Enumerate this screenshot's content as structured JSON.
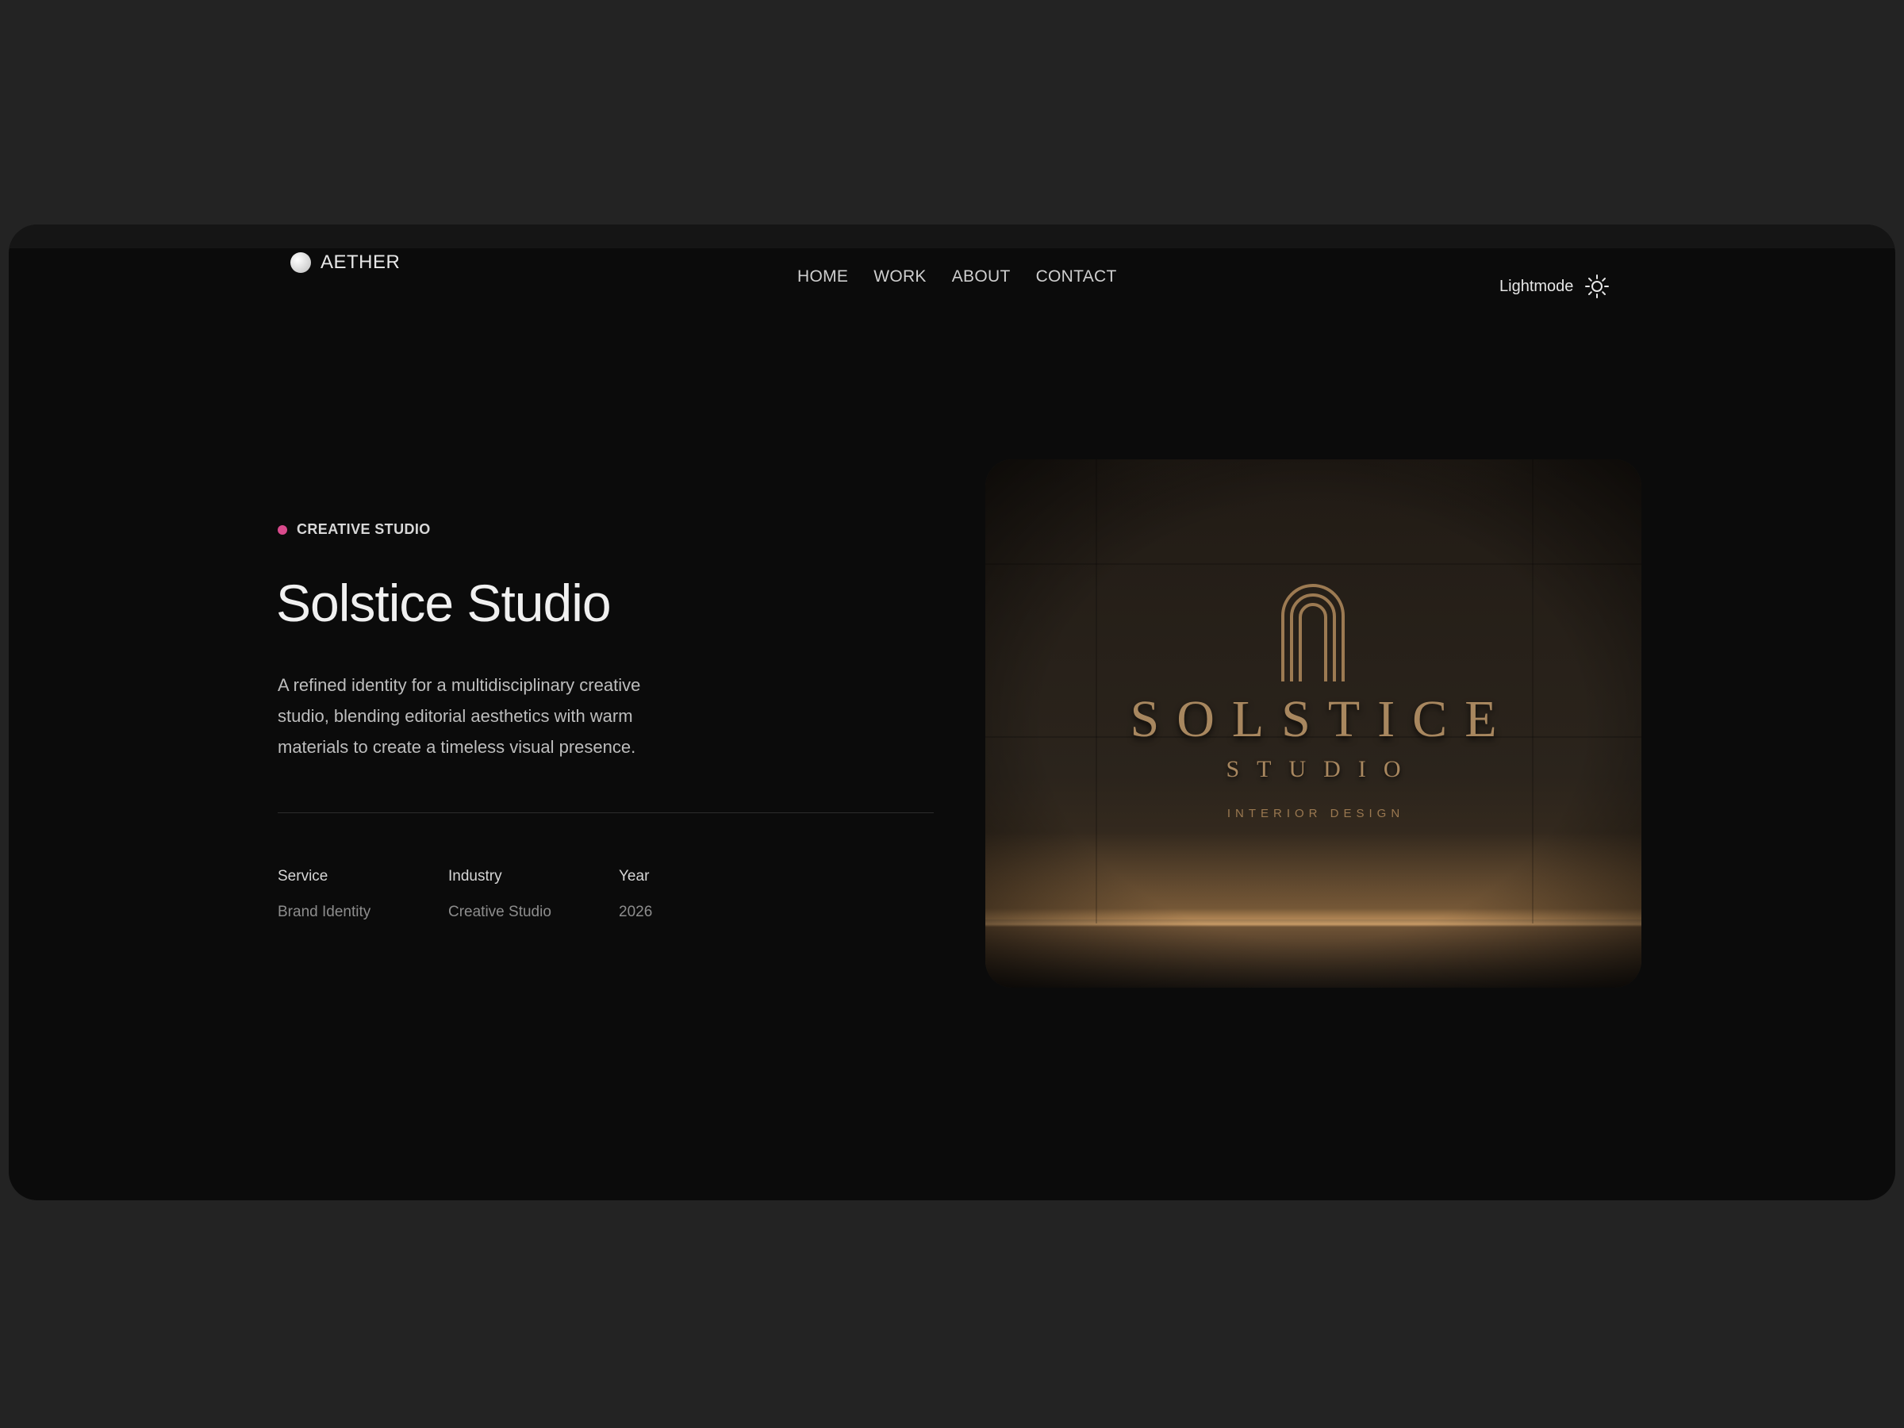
{
  "brand": {
    "name": "AETHER"
  },
  "nav": {
    "items": [
      {
        "label": "HOME"
      },
      {
        "label": "WORK"
      },
      {
        "label": "ABOUT"
      },
      {
        "label": "CONTACT"
      }
    ],
    "theme_label": "Lightmode"
  },
  "hero": {
    "eyebrow": "CREATIVE STUDIO",
    "title": "Solstice Studio",
    "description": "A refined identity for a multidisciplinary creative studio, blending editorial aesthetics with warm materials to create a timeless visual presence.",
    "meta": [
      {
        "label": "Service",
        "value": "Brand Identity"
      },
      {
        "label": "Industry",
        "value": "Creative Studio"
      },
      {
        "label": "Year",
        "value": "2026"
      }
    ]
  },
  "image": {
    "brand_name": "SOLSTICE",
    "brand_sub": "STUDIO",
    "brand_tag": "INTERIOR DESIGN"
  },
  "colors": {
    "accent": "#d94a8c",
    "background": "#0b0b0b",
    "outer": "#232323",
    "gold": "#a8875f"
  },
  "icons": {
    "theme": "sun-icon",
    "logo": "circle-logo-icon"
  }
}
